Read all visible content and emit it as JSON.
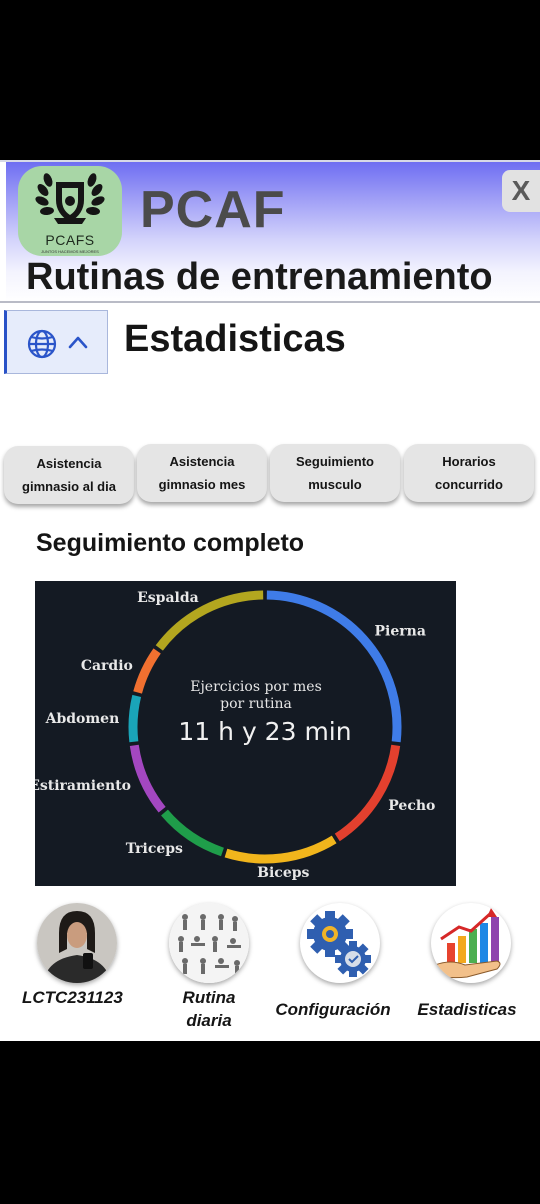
{
  "header": {
    "logo_text": "PCAFS",
    "logo_slogan": "JUNTOS HACEMOS MEJORES",
    "brand": "PCAF",
    "close_label": "X",
    "subtitle": "Rutinas de entrenamiento"
  },
  "page": {
    "title": "Estadisticas"
  },
  "tabs": [
    {
      "line1": "Asistencia",
      "line2": "gimnasio al dia"
    },
    {
      "line1": "Asistencia",
      "line2": "gimnasio mes"
    },
    {
      "line1": "Seguimiento",
      "line2": "musculo"
    },
    {
      "line1": "Horarios",
      "line2": "concurrido"
    }
  ],
  "section_title": "Seguimiento completo",
  "chart_data": {
    "type": "pie",
    "style": "donut-ring",
    "center_title_line1": "Ejercicios por mes",
    "center_title_line2": "por rutina",
    "center_value": "11 h y 23 min",
    "slices": [
      {
        "label": "Pierna",
        "value": 27,
        "color": "#3f7ce8"
      },
      {
        "label": "Pecho",
        "value": 14,
        "color": "#e3402e"
      },
      {
        "label": "Biceps",
        "value": 14,
        "color": "#f1b51c"
      },
      {
        "label": "Triceps",
        "value": 9,
        "color": "#1f9d4a"
      },
      {
        "label": "Estiramiento",
        "value": 9,
        "color": "#a347c0"
      },
      {
        "label": "Abdomen",
        "value": 6,
        "color": "#1aa4b8"
      },
      {
        "label": "Cardio",
        "value": 6,
        "color": "#f07030"
      },
      {
        "label": "Espalda",
        "value": 15,
        "color": "#b3a61f"
      }
    ]
  },
  "bottom_nav": [
    {
      "label": "LCTC231123",
      "icon": "user-avatar"
    },
    {
      "label_line1": "Rutina",
      "label_line2": "diaria",
      "icon": "exercise-sheet-icon"
    },
    {
      "label": "Configuración",
      "icon": "gears-icon"
    },
    {
      "label": "Estadisticas",
      "icon": "growth-chart-icon"
    }
  ]
}
